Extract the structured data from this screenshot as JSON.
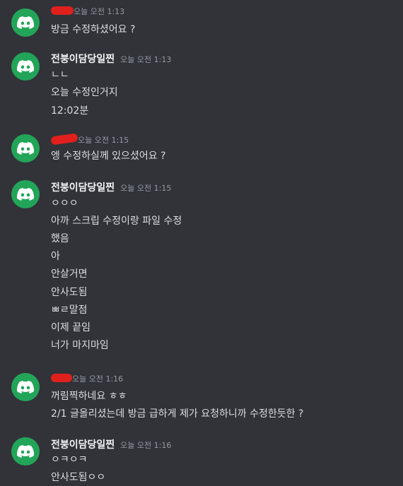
{
  "colors": {
    "background": "#313338",
    "avatar": "#23a559",
    "redaction": "#e0201c"
  },
  "avatar_icon": "discord-logo-icon",
  "messages": [
    {
      "author": "",
      "redacted": true,
      "time": "오늘 오전 1:13",
      "lines": [
        "방금 수정하셨어요 ?"
      ]
    },
    {
      "author": "전붕이담당일찐",
      "redacted": false,
      "time": "오늘 오전 1:13",
      "lines": [
        "ㄴㄴ",
        "오늘 수정인거지",
        "12:02분"
      ]
    },
    {
      "author": "",
      "redacted": true,
      "time": "오늘 오전 1:15",
      "lines": [
        "엥 수정하실께 있으셨어요 ?"
      ]
    },
    {
      "author": "전붕이담당일찐",
      "redacted": false,
      "time": "오늘 오전 1:15",
      "lines": [
        "ㅇㅇㅇ",
        "아까 스크립 수정이랑 파일 수정",
        "했음",
        "아",
        "안살거면",
        "안사도됨",
        "ㅃㄹ말점",
        "이제 끝임",
        "너가 마지마임"
      ]
    },
    {
      "author": "",
      "redacted": true,
      "time": "오늘 오전 1:16",
      "lines": [
        "꺼림찍하네요 ㅎㅎ",
        "2/1 글올리셨는데 방금 급하게 제가 요청하니까 수정한듯한 ?"
      ]
    },
    {
      "author": "전붕이담당일찐",
      "redacted": false,
      "time": "오늘 오전 1:16",
      "lines": [
        "ㅇㅋㅇㅋ",
        "안사도됨ㅇㅇ"
      ]
    }
  ]
}
